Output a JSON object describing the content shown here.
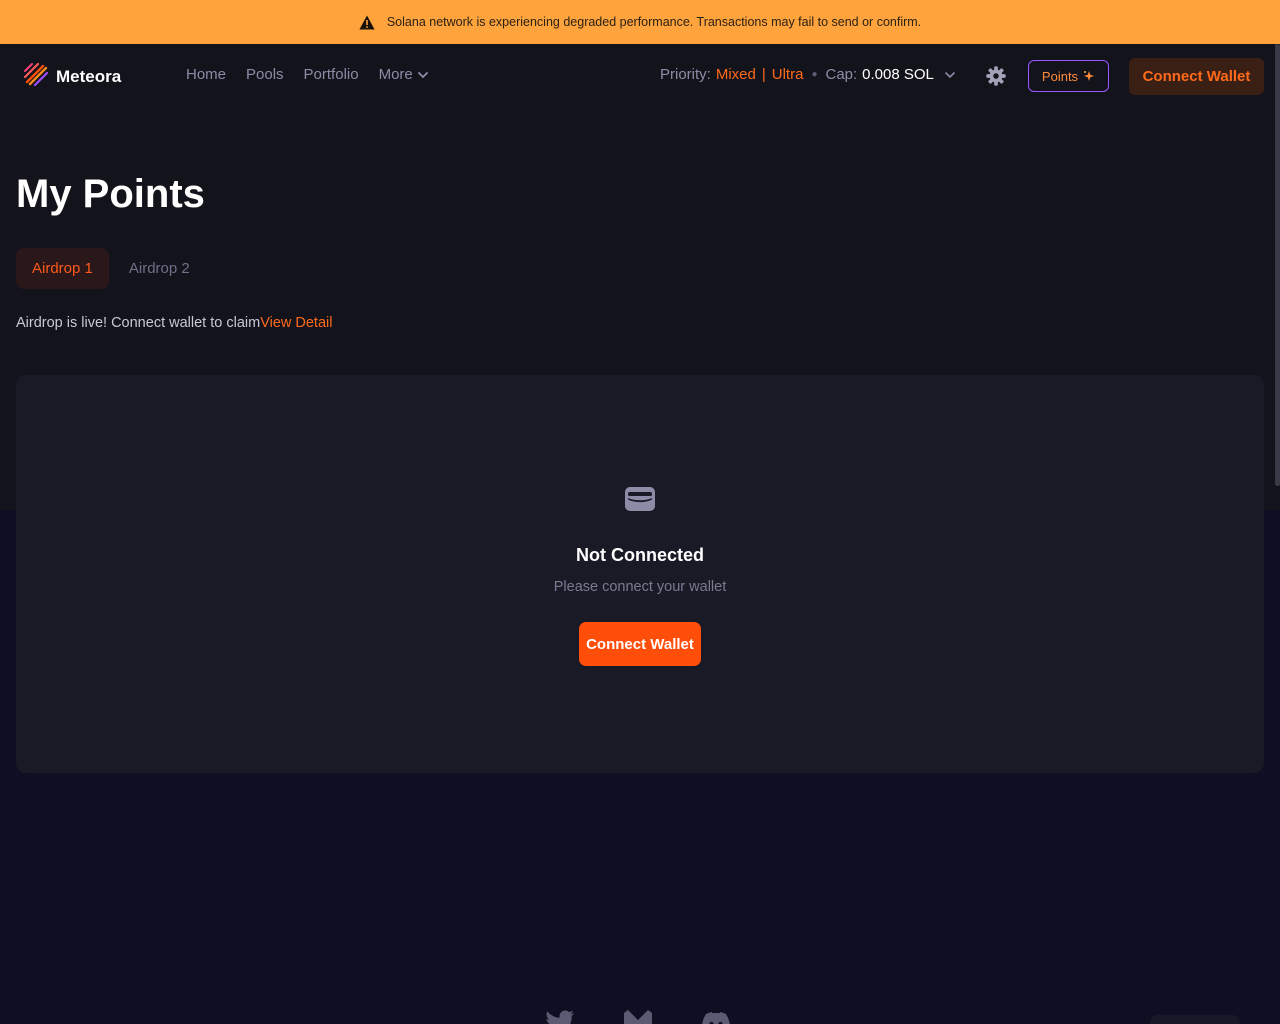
{
  "banner": {
    "icon": "warning-icon",
    "text": "Solana network is experiencing degraded performance. Transactions may fail to send or confirm."
  },
  "nav": {
    "brand": "Meteora",
    "logo_icon": "meteora-logo-icon",
    "items": [
      {
        "label": "Home"
      },
      {
        "label": "Pools"
      },
      {
        "label": "Portfolio"
      },
      {
        "label": "More"
      }
    ],
    "priority": {
      "label": "Priority:",
      "mode": "Mixed",
      "level": "Ultra",
      "cap_label": "Cap:",
      "cap_value": "0.008 SOL"
    },
    "settings_icon": "gear-icon",
    "points_label": "Points",
    "connect_label": "Connect Wallet"
  },
  "page": {
    "title": "My Points",
    "tabs": [
      {
        "label": "Airdrop 1",
        "active": true
      },
      {
        "label": "Airdrop 2",
        "active": false
      }
    ],
    "notice_text": "Airdrop is live! Connect wallet to claim",
    "notice_link": "View Detail"
  },
  "card": {
    "icon": "wallet-icon",
    "title": "Not Connected",
    "subtitle": "Please connect your wallet",
    "button_label": "Connect Wallet"
  },
  "footer": {
    "icons": [
      "twitter-icon",
      "medium-icon",
      "discord-icon"
    ]
  },
  "colors": {
    "accent": "#ff4e0a",
    "banner": "#ffa43d",
    "background": "#0e0f22"
  }
}
